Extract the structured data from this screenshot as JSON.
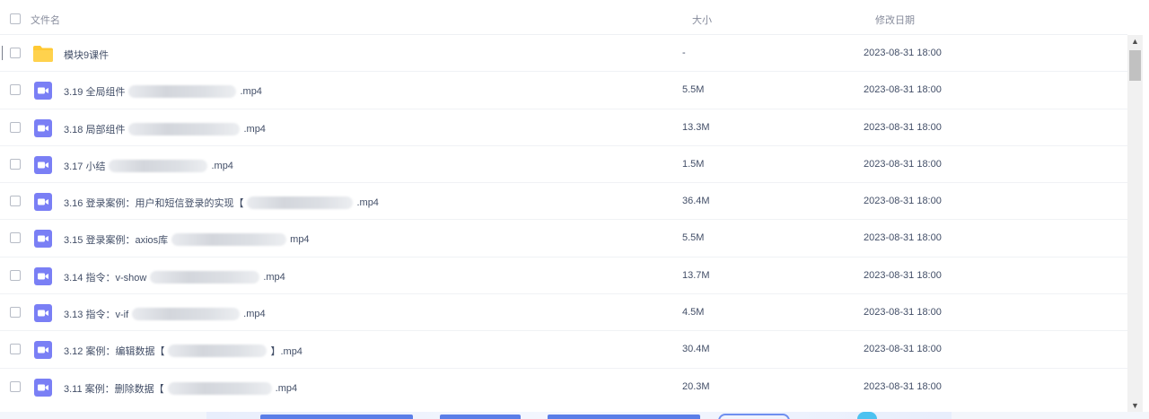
{
  "header": {
    "name_label": "文件名",
    "size_label": "大小",
    "date_label": "修改日期"
  },
  "files": [
    {
      "type": "folder",
      "name_prefix": "模块9课件",
      "name_suffix": "",
      "size": "-",
      "date": "2023-08-31 18:00"
    },
    {
      "type": "video",
      "name_prefix": "3.19 全局组件",
      "name_suffix": ".mp4",
      "size": "5.5M",
      "date": "2023-08-31 18:00"
    },
    {
      "type": "video",
      "name_prefix": "3.18 局部组件",
      "name_suffix": ".mp4",
      "size": "13.3M",
      "date": "2023-08-31 18:00"
    },
    {
      "type": "video",
      "name_prefix": "3.17 小结",
      "name_suffix": ".mp4",
      "size": "1.5M",
      "date": "2023-08-31 18:00"
    },
    {
      "type": "video",
      "name_prefix": "3.16 登录案例：用户和短信登录的实现【",
      "name_suffix": ".mp4",
      "size": "36.4M",
      "date": "2023-08-31 18:00"
    },
    {
      "type": "video",
      "name_prefix": "3.15 登录案例：axios库",
      "name_suffix": "mp4",
      "size": "5.5M",
      "date": "2023-08-31 18:00"
    },
    {
      "type": "video",
      "name_prefix": "3.14 指令：v-show",
      "name_suffix": ".mp4",
      "size": "13.7M",
      "date": "2023-08-31 18:00"
    },
    {
      "type": "video",
      "name_prefix": "3.13 指令：v-if",
      "name_suffix": ".mp4",
      "size": "4.5M",
      "date": "2023-08-31 18:00"
    },
    {
      "type": "video",
      "name_prefix": "3.12 案例：编辑数据【",
      "name_suffix": "】.mp4",
      "size": "30.4M",
      "date": "2023-08-31 18:00"
    },
    {
      "type": "video",
      "name_prefix": "3.11 案例：删除数据【",
      "name_suffix": ".mp4",
      "size": "20.3M",
      "date": "2023-08-31 18:00"
    }
  ],
  "icons": {
    "folder": "folder-icon",
    "video": "video-file-icon",
    "scroll_up": "chevron-up-icon",
    "scroll_down": "chevron-down-icon"
  },
  "colors": {
    "folder": "#ffc933",
    "video": "#7a7ff5",
    "text": "#424e67",
    "header_text": "#878c9c"
  }
}
